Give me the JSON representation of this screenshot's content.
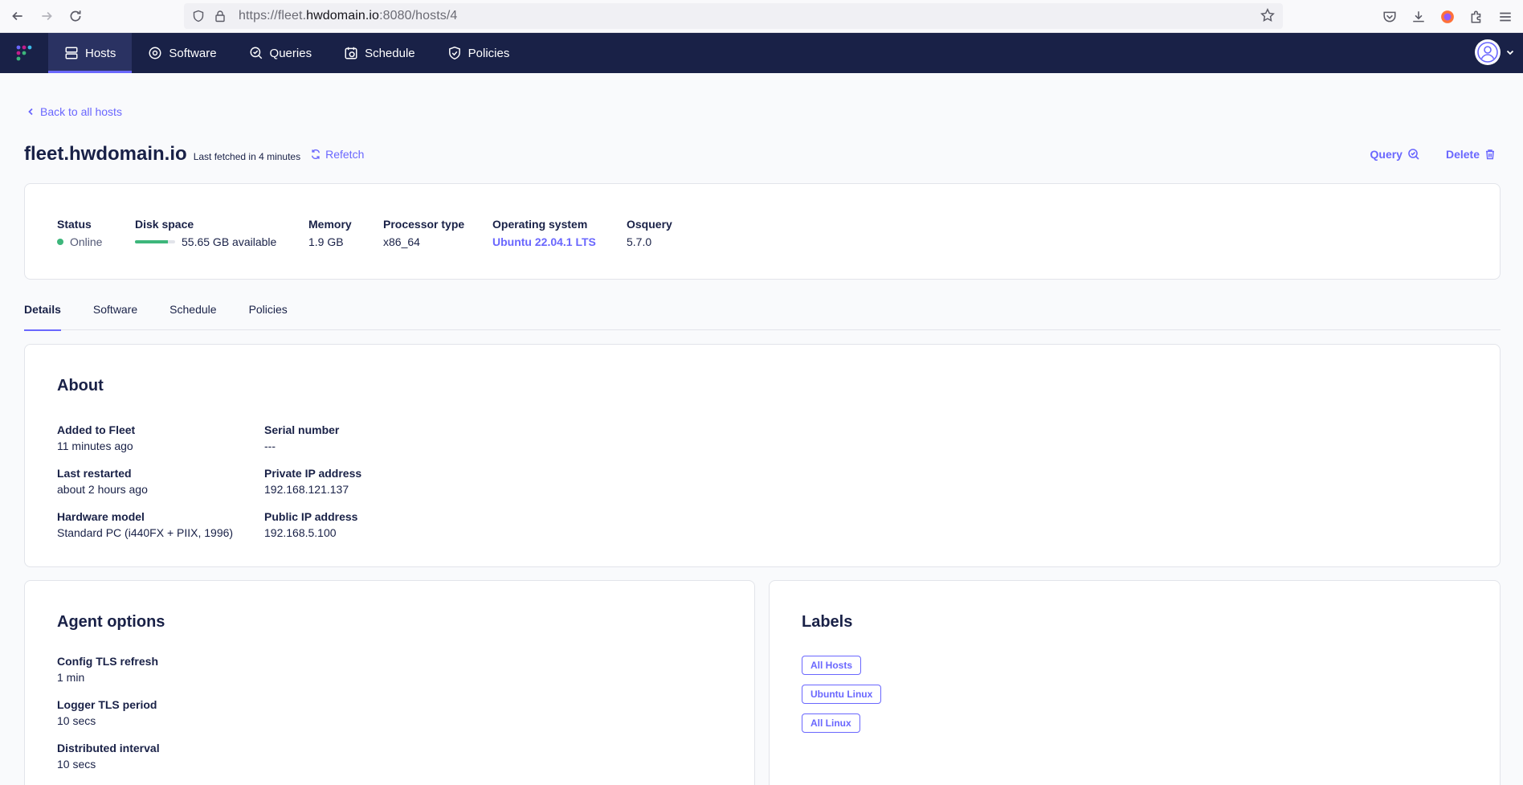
{
  "browser": {
    "url_prefix": "https://fleet.",
    "url_domain": "hwdomain.io",
    "url_suffix": ":8080/hosts/4"
  },
  "nav": {
    "items": [
      {
        "label": "Hosts",
        "icon": "hosts-icon",
        "active": true
      },
      {
        "label": "Software",
        "icon": "software-icon",
        "active": false
      },
      {
        "label": "Queries",
        "icon": "queries-icon",
        "active": false
      },
      {
        "label": "Schedule",
        "icon": "schedule-icon",
        "active": false
      },
      {
        "label": "Policies",
        "icon": "policies-icon",
        "active": false
      }
    ]
  },
  "page": {
    "back_label": "Back to all hosts",
    "host_name": "fleet.hwdomain.io",
    "last_fetched": "Last fetched in 4 minutes",
    "refetch_label": "Refetch",
    "query_label": "Query",
    "delete_label": "Delete"
  },
  "summary": {
    "status_label": "Status",
    "status_value": "Online",
    "disk_label": "Disk space",
    "disk_value": "55.65 GB available",
    "disk_fill_fraction": 0.82,
    "memory_label": "Memory",
    "memory_value": "1.9 GB",
    "processor_label": "Processor type",
    "processor_value": "x86_64",
    "os_label": "Operating system",
    "os_value": "Ubuntu 22.04.1 LTS",
    "osquery_label": "Osquery",
    "osquery_value": "5.7.0"
  },
  "tabs": [
    "Details",
    "Software",
    "Schedule",
    "Policies"
  ],
  "about": {
    "title": "About",
    "added_label": "Added to Fleet",
    "added_value": "11 minutes ago",
    "serial_label": "Serial number",
    "serial_value": "---",
    "restarted_label": "Last restarted",
    "restarted_value": "about 2 hours ago",
    "private_ip_label": "Private IP address",
    "private_ip_value": "192.168.121.137",
    "hardware_label": "Hardware model",
    "hardware_value": "Standard PC (i440FX + PIIX, 1996)",
    "public_ip_label": "Public IP address",
    "public_ip_value": "192.168.5.100"
  },
  "agent": {
    "title": "Agent options",
    "config_label": "Config TLS refresh",
    "config_value": "1 min",
    "logger_label": "Logger TLS period",
    "logger_value": "10 secs",
    "distributed_label": "Distributed interval",
    "distributed_value": "10 secs"
  },
  "labels": {
    "title": "Labels",
    "items": [
      "All Hosts",
      "Ubuntu Linux",
      "All Linux"
    ]
  },
  "colors": {
    "nav_bg": "#192147",
    "accent": "#6a67fe",
    "online": "#3db67b"
  }
}
